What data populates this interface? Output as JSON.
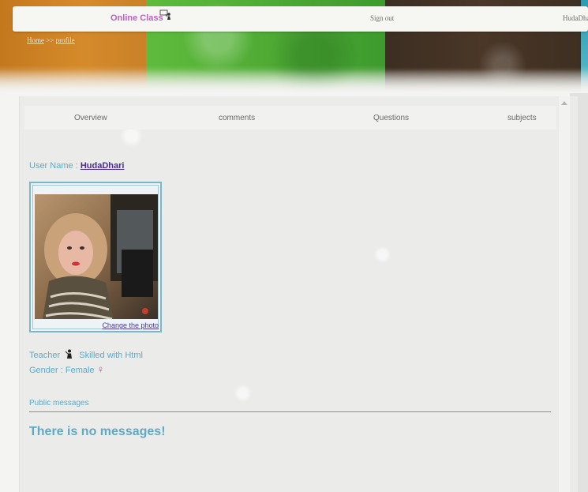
{
  "topbar": {
    "brand": "Online Class",
    "brand_icon": "teacher-board-icon",
    "signout": "Sign out",
    "user": "HudaDhari"
  },
  "breadcrumb": {
    "home": "Home",
    "separator": ">>",
    "current": "profile"
  },
  "tabs": [
    {
      "label": "Overview"
    },
    {
      "label": "comments"
    },
    {
      "label": "Questions"
    },
    {
      "label": "subjects"
    }
  ],
  "profile": {
    "user_name_label": "User Name :",
    "user_name": "HudaDhari",
    "change_photo": "Change the photo",
    "role": "Teacher",
    "skill": "Skilled with Html",
    "gender_label": "Gender : Female",
    "gender_icon": "♀"
  },
  "messages": {
    "label": "Public messages",
    "empty": "There is no messages!"
  },
  "colors": {
    "accent_text": "#5fa9c5",
    "brand": "#c060c0",
    "link": "#4a2d8f"
  }
}
